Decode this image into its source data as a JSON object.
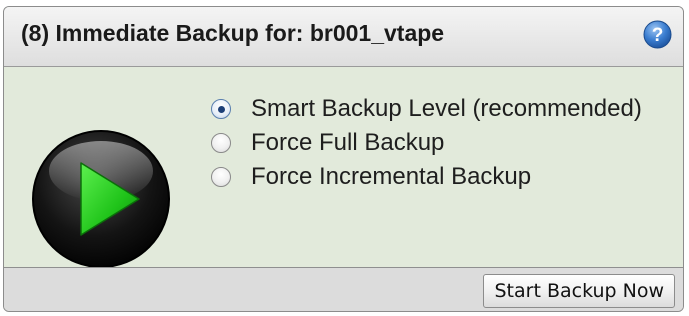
{
  "panel": {
    "title": "(8) Immediate Backup for: br001_vtape",
    "help_icon": "help-question-icon",
    "play_icon": "play-icon"
  },
  "options": [
    {
      "label": "Smart Backup Level (recommended)",
      "selected": true
    },
    {
      "label": "Force Full Backup",
      "selected": false
    },
    {
      "label": "Force Incremental Backup",
      "selected": false
    }
  ],
  "footer": {
    "start_button_label": "Start Backup Now"
  },
  "colors": {
    "panel_bg": "#e2eadb",
    "play_green": "#22c81e",
    "help_blue": "#2f6fc6"
  }
}
